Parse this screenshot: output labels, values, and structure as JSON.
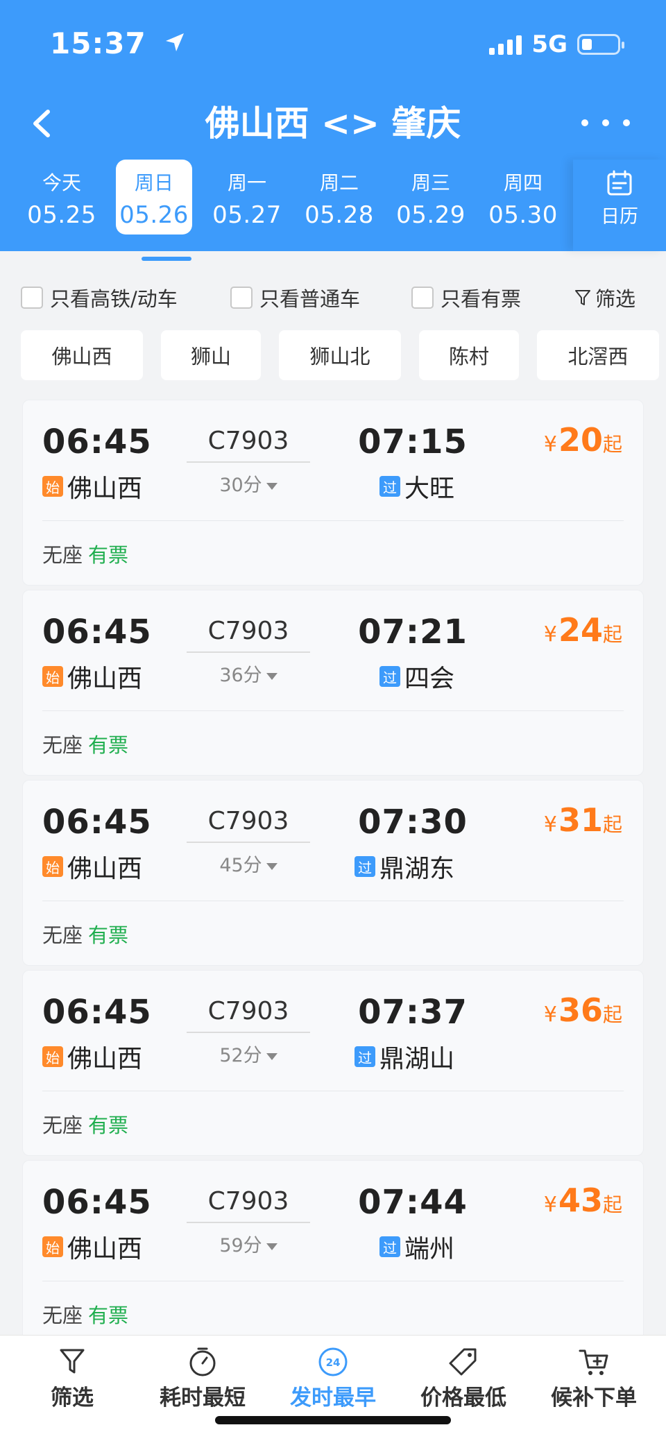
{
  "status_bar": {
    "time": "15:37",
    "network": "5G"
  },
  "nav": {
    "title": "佛山西 <> 肇庆"
  },
  "dates": [
    {
      "weekday": "今天",
      "date": "05.25",
      "active": false
    },
    {
      "weekday": "周日",
      "date": "05.26",
      "active": true
    },
    {
      "weekday": "周一",
      "date": "05.27",
      "active": false
    },
    {
      "weekday": "周二",
      "date": "05.28",
      "active": false
    },
    {
      "weekday": "周三",
      "date": "05.29",
      "active": false
    },
    {
      "weekday": "周四",
      "date": "05.30",
      "active": false
    }
  ],
  "calendar_label": "日历",
  "filters": {
    "checks": [
      "只看高铁/动车",
      "只看普通车",
      "只看有票"
    ],
    "filter_label": "筛选"
  },
  "stations": [
    "佛山西",
    "狮山",
    "狮山北",
    "陈村",
    "北滘西"
  ],
  "trains": [
    {
      "dep": "06:45",
      "no": "C7903",
      "dur": "30分",
      "arr": "07:15",
      "from_badge": "始",
      "from": "佛山西",
      "to_badge": "过",
      "to": "大旺",
      "price": "20",
      "seat": "无座",
      "avail": "有票"
    },
    {
      "dep": "06:45",
      "no": "C7903",
      "dur": "36分",
      "arr": "07:21",
      "from_badge": "始",
      "from": "佛山西",
      "to_badge": "过",
      "to": "四会",
      "price": "24",
      "seat": "无座",
      "avail": "有票"
    },
    {
      "dep": "06:45",
      "no": "C7903",
      "dur": "45分",
      "arr": "07:30",
      "from_badge": "始",
      "from": "佛山西",
      "to_badge": "过",
      "to": "鼎湖东",
      "price": "31",
      "seat": "无座",
      "avail": "有票"
    },
    {
      "dep": "06:45",
      "no": "C7903",
      "dur": "52分",
      "arr": "07:37",
      "from_badge": "始",
      "from": "佛山西",
      "to_badge": "过",
      "to": "鼎湖山",
      "price": "36",
      "seat": "无座",
      "avail": "有票"
    },
    {
      "dep": "06:45",
      "no": "C7903",
      "dur": "59分",
      "arr": "07:44",
      "from_badge": "始",
      "from": "佛山西",
      "to_badge": "过",
      "to": "端州",
      "price": "43",
      "seat": "无座",
      "avail": "有票"
    }
  ],
  "price_symbols": {
    "yen": "¥",
    "from": "起"
  },
  "tabs": [
    {
      "label": "筛选",
      "icon": "filter-icon",
      "active": false
    },
    {
      "label": "耗时最短",
      "icon": "timer-icon",
      "active": false
    },
    {
      "label": "发时最早",
      "icon": "clock-24-icon",
      "active": true,
      "icon_text": "24"
    },
    {
      "label": "价格最低",
      "icon": "price-tag-icon",
      "active": false
    },
    {
      "label": "候补下单",
      "icon": "cart-icon",
      "active": false
    }
  ],
  "colors": {
    "primary": "#3d9bfb",
    "price": "#ff7a1a",
    "available": "#1fae4e",
    "start_badge": "#ff8a2b"
  }
}
